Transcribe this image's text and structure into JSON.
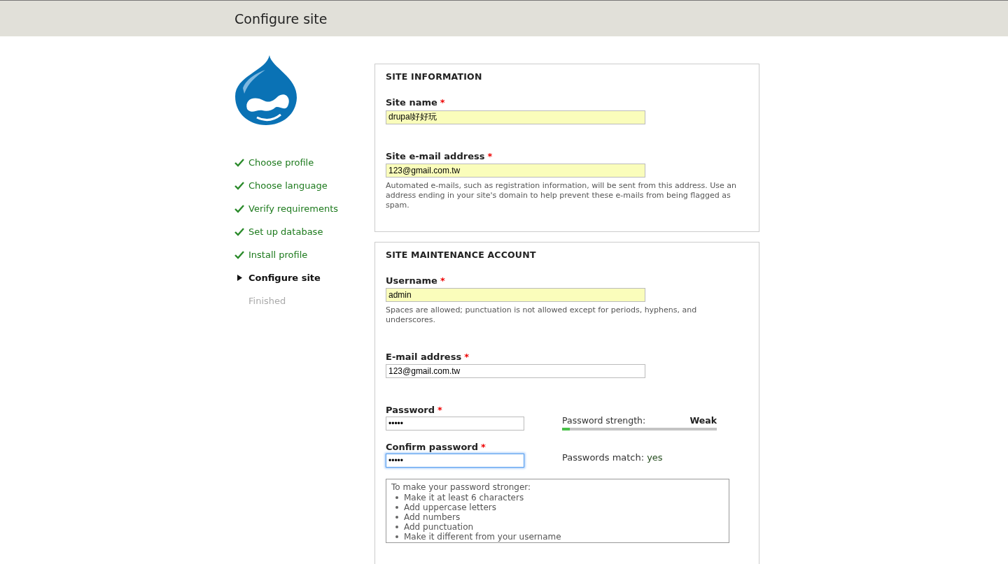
{
  "header": {
    "title": "Configure site"
  },
  "steps": [
    {
      "label": "Choose profile",
      "kind": "done"
    },
    {
      "label": "Choose language",
      "kind": "done"
    },
    {
      "label": "Verify requirements",
      "kind": "done"
    },
    {
      "label": "Set up database",
      "kind": "done"
    },
    {
      "label": "Install profile",
      "kind": "done"
    },
    {
      "label": "Configure site",
      "kind": "current"
    },
    {
      "label": "Finished",
      "kind": "pending"
    }
  ],
  "sections": [
    {
      "title": "SITE INFORMATION",
      "fields": [
        {
          "kind": "text",
          "label": "Site name",
          "required": "*",
          "value": "drupal好好玩",
          "highlighted": true,
          "focused": false
        },
        {
          "kind": "text",
          "label": "Site e-mail address",
          "required": "*",
          "value": "123@gmail.com.tw",
          "highlighted": true,
          "focused": false,
          "description": "Automated e-mails, such as registration information, will be sent from this address. Use an address ending in your site's domain to help prevent these e-mails from being flagged as spam."
        }
      ]
    },
    {
      "title": "SITE MAINTENANCE ACCOUNT",
      "fields": [
        {
          "kind": "text",
          "label": "Username",
          "required": "*",
          "value": "admin",
          "highlighted": true,
          "focused": false,
          "description": "Spaces are allowed; punctuation is not allowed except for periods, hyphens, and underscores."
        },
        {
          "kind": "text",
          "label": "E-mail address",
          "required": "*",
          "value": "123@gmail.com.tw",
          "highlighted": false,
          "focused": false
        },
        {
          "kind": "password",
          "label": "Password",
          "required": "*",
          "value": "•••••",
          "highlighted": false,
          "focused": false,
          "strength": {
            "label": "Password strength:",
            "value": "Weak",
            "level": 0.05
          }
        },
        {
          "kind": "confirm",
          "label": "Confirm password",
          "required": "*",
          "value": "•••••",
          "highlighted": false,
          "focused": true,
          "match": {
            "label": "Passwords match:",
            "value": "yes"
          }
        }
      ],
      "suggestions": {
        "title": "To make your password stronger:",
        "items": [
          "Make it at least 6 characters",
          "Add uppercase letters",
          "Add numbers",
          "Add punctuation",
          "Make it different from your username"
        ]
      }
    }
  ]
}
